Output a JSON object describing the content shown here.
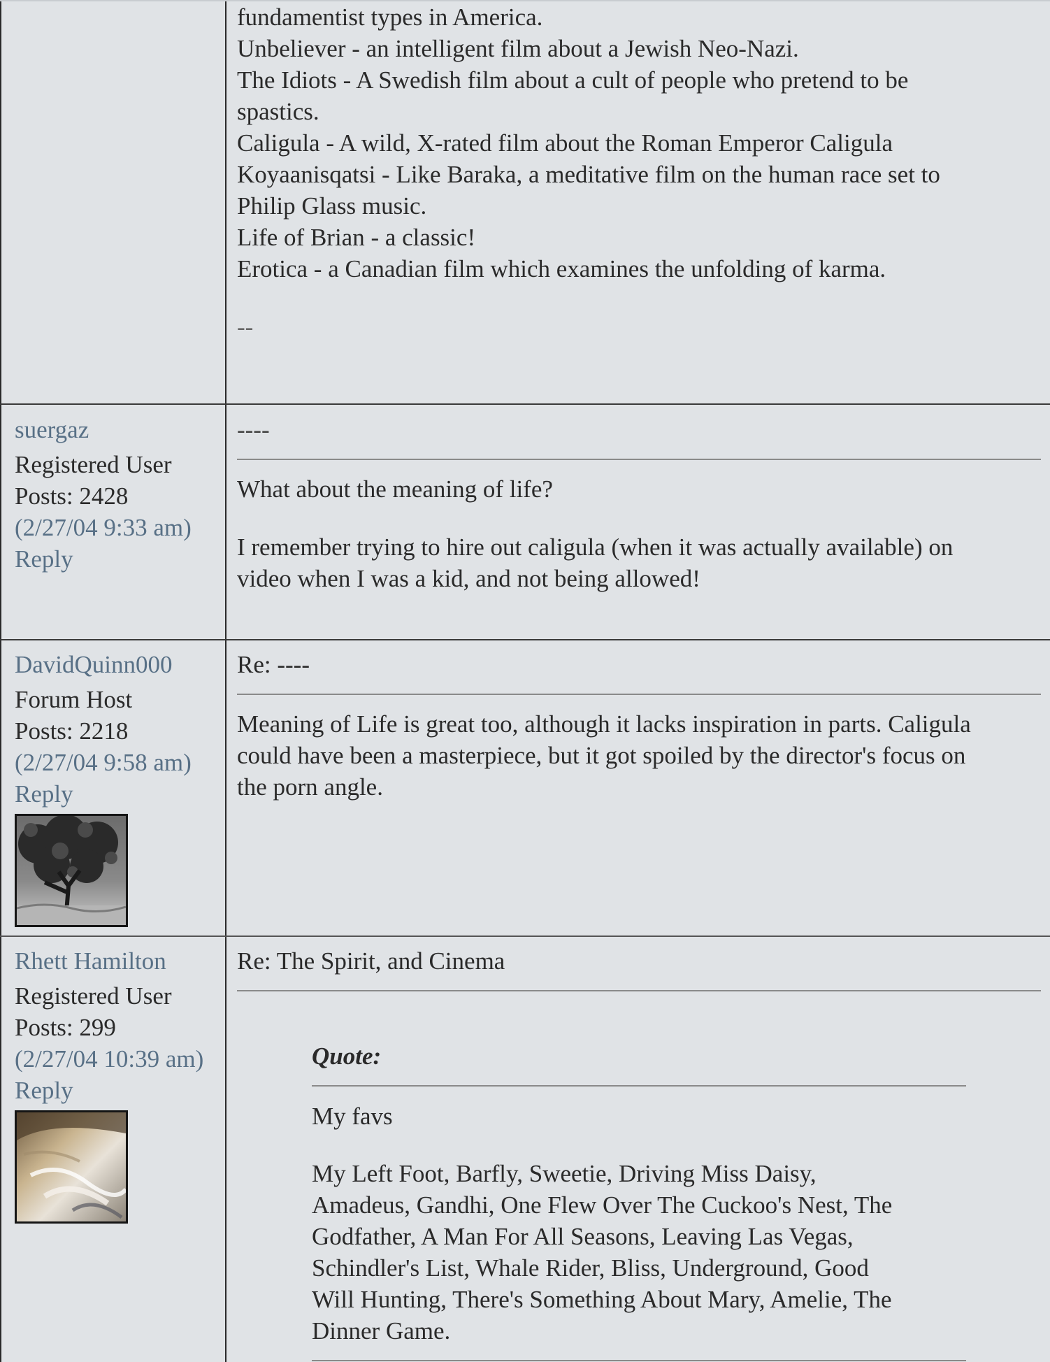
{
  "post0": {
    "body_lines": [
      "fundamentist types in America.",
      "Unbeliever - an intelligent film about a Jewish Neo-Nazi.",
      "The Idiots - A Swedish film about a cult of people who pretend to be",
      "spastics.",
      "Caligula - A wild, X-rated film about the Roman Emperor Caligula",
      "Koyaanisqatsi - Like Baraka, a meditative film on the human race set to",
      "Philip Glass music.",
      "Life of Brian - a classic!",
      "Erotica - a Canadian film which examines the unfolding of karma."
    ],
    "signature": "--"
  },
  "post1": {
    "username": "suergaz",
    "role": "Registered User",
    "posts": "Posts: 2428",
    "timestamp": "(2/27/04 9:33 am)",
    "reply": "Reply",
    "subject": "----",
    "para1": "What about the meaning of life?",
    "para2_lines": [
      "I remember trying to hire out caligula (when it was actually available) on",
      "video when I was a kid, and not being allowed!"
    ]
  },
  "post2": {
    "username": "DavidQuinn000",
    "role": "Forum Host",
    "posts": "Posts: 2218",
    "timestamp": "(2/27/04 9:58 am)",
    "reply": "Reply",
    "subject": "Re: ----",
    "body_lines": [
      "Meaning of Life is great too, although it lacks inspiration in parts. Caligula",
      "could have been a masterpiece, but it got spoiled by the director's focus on",
      "the porn angle."
    ]
  },
  "post3": {
    "username": "Rhett Hamilton",
    "role": "Registered User",
    "posts": "Posts: 299",
    "timestamp": "(2/27/04 10:39 am)",
    "reply": "Reply",
    "subject": "Re: The Spirit, and Cinema",
    "quote_label": "Quote:",
    "quote_para1": "My favs",
    "quote_para2_lines": [
      "My Left Foot, Barfly, Sweetie, Driving Miss Daisy,",
      "Amadeus, Gandhi, One Flew Over The Cuckoo's Nest, The",
      "Godfather, A Man For All Seasons, Leaving Las Vegas,",
      "Schindler's List, Whale Rider, Bliss, Underground, Good",
      "Will Hunting, There's Something About Mary, Amelie, The",
      "Dinner Game."
    ]
  },
  "colors": {
    "background": "#e0e3e6",
    "link": "#587086",
    "text": "#2a2a2a",
    "border": "#2a2a2a",
    "rule": "#8a8a8a"
  }
}
